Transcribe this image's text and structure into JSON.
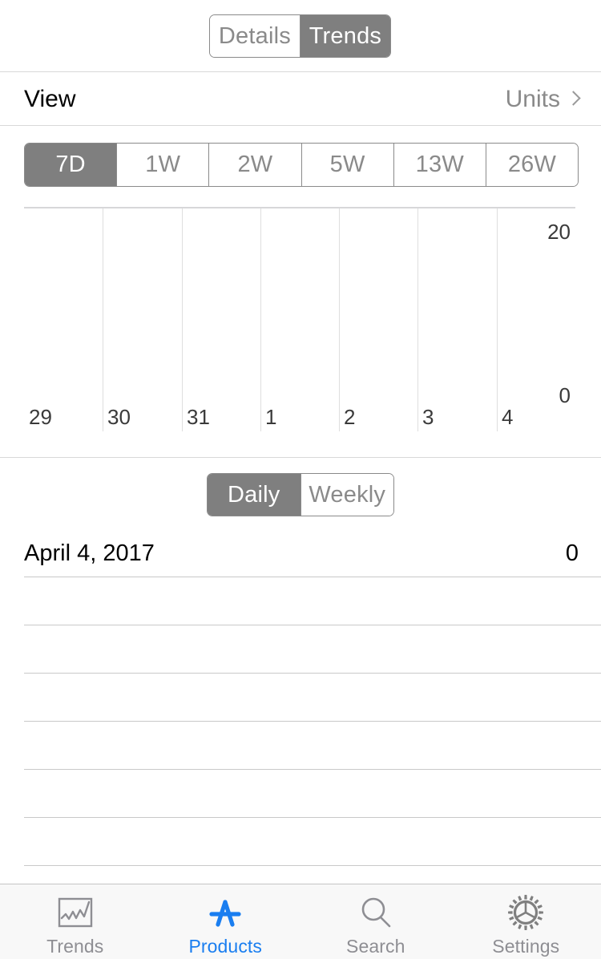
{
  "header": {
    "segments": [
      {
        "label": "Details",
        "selected": false
      },
      {
        "label": "Trends",
        "selected": true
      }
    ]
  },
  "view_row": {
    "label": "View",
    "value": "Units",
    "chevron_icon": "chevron-right-icon"
  },
  "range_selector": {
    "options": [
      {
        "label": "7D",
        "selected": true
      },
      {
        "label": "1W",
        "selected": false
      },
      {
        "label": "2W",
        "selected": false
      },
      {
        "label": "5W",
        "selected": false
      },
      {
        "label": "13W",
        "selected": false
      },
      {
        "label": "26W",
        "selected": false
      }
    ]
  },
  "granularity": {
    "options": [
      {
        "label": "Daily",
        "selected": true
      },
      {
        "label": "Weekly",
        "selected": false
      }
    ]
  },
  "detail_list": {
    "rows": [
      {
        "title": "April 4, 2017",
        "value": "0"
      },
      {
        "title": "",
        "value": ""
      },
      {
        "title": "",
        "value": ""
      },
      {
        "title": "",
        "value": ""
      },
      {
        "title": "",
        "value": ""
      },
      {
        "title": "",
        "value": ""
      },
      {
        "title": "",
        "value": ""
      }
    ]
  },
  "tabbar": {
    "tabs": [
      {
        "label": "Trends",
        "icon": "line-chart-icon",
        "active": false
      },
      {
        "label": "Products",
        "icon": "app-store-icon",
        "active": true
      },
      {
        "label": "Search",
        "icon": "search-icon",
        "active": false
      },
      {
        "label": "Settings",
        "icon": "gear-icon",
        "active": false
      }
    ]
  },
  "colors": {
    "selected_segment_bg": "#7f7f7f",
    "segment_border": "#8a8a8a",
    "accent": "#1a7ef0",
    "inactive_tab": "#8e8e93",
    "gridline": "#dedede",
    "separator": "#d9d9d9"
  },
  "chart_data": {
    "type": "bar",
    "title": "",
    "xlabel": "",
    "ylabel": "Units",
    "categories": [
      "29",
      "30",
      "31",
      "1",
      "2",
      "3",
      "4"
    ],
    "values": [
      0,
      0,
      0,
      0,
      0,
      0,
      0
    ],
    "ylim": [
      0,
      20
    ],
    "ytick_labels": [
      "20",
      "0"
    ],
    "ytick_values": [
      20,
      0
    ],
    "grid": true,
    "legend": "none",
    "range": "7D",
    "granularity": "Daily"
  }
}
